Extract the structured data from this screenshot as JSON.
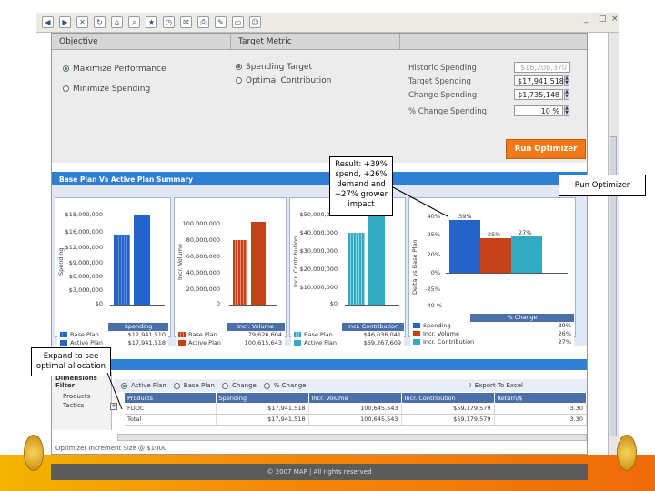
{
  "browser": {
    "window_controls": [
      "_",
      "□",
      "×"
    ]
  },
  "objective": {
    "header": "Objective",
    "options": [
      {
        "label": "Maximize Performance",
        "selected": true
      },
      {
        "label": "Minimize Spending",
        "selected": false
      }
    ]
  },
  "target_metric": {
    "header": "Target Metric",
    "options": [
      {
        "label": "Spending Target",
        "selected": true
      },
      {
        "label": "Optimal Contribution",
        "selected": false
      }
    ],
    "fields": [
      {
        "label": "Historic Spending",
        "value": "$16,206,370",
        "disabled": true
      },
      {
        "label": "Target Spending",
        "value": "$17,941,518",
        "disabled": false
      },
      {
        "label": "Change Spending",
        "value": "$1,735,148",
        "disabled": false
      },
      {
        "label": "% Change Spending",
        "value": "10 %",
        "disabled": false
      }
    ]
  },
  "run_button": {
    "label": "Run Optimizer"
  },
  "summary": {
    "title": "Base Plan Vs Active Plan Summary",
    "colors": {
      "base": "#2563c9",
      "volume": "#c6401a",
      "contribution": "#33aac0"
    },
    "spending_chart": {
      "ylabel": "Spending",
      "ticks": [
        "$18,000,000",
        "$16,000,000",
        "$12,000,000",
        "$9,000,000",
        "$6,000,000",
        "$3,000,000",
        "$0"
      ],
      "legend_header": "Spending",
      "rows": [
        {
          "label": "Base Plan",
          "value": "$12,941,510"
        },
        {
          "label": "Active Plan",
          "value": "$17,941,518"
        }
      ]
    },
    "volume_chart": {
      "ylabel": "Incr. Volume",
      "ticks": [
        "100,000,000",
        "80,000,000",
        "60,000,000",
        "40,000,000",
        "20,000,000",
        "0"
      ],
      "legend_header": "Incr. Volume",
      "rows": [
        {
          "label": "Base Plan",
          "value": "79,626,604"
        },
        {
          "label": "Active Plan",
          "value": "100,615,643"
        }
      ]
    },
    "contribution_chart": {
      "ylabel": "Incr. Contribution",
      "ticks": [
        "$50,000,000",
        "$40,000,000",
        "$30,000,000",
        "$20,000,000",
        "$10,000,000",
        "$0"
      ],
      "legend_header": "Incr. Contribution",
      "rows": [
        {
          "label": "Base Plan",
          "value": "$46,036,041"
        },
        {
          "label": "Active Plan",
          "value": "$69,267,609"
        }
      ]
    },
    "delta_chart": {
      "ylabel": "Delta vs Base Plan",
      "ticks": [
        "40%",
        "25%",
        "20%",
        "0%",
        "-25%",
        "-40 %"
      ],
      "bar_labels": [
        "39%",
        "25%",
        "27%"
      ],
      "legend_header": "% Change",
      "rows": [
        {
          "label": "Spending",
          "value": "39%"
        },
        {
          "label": "Incr. Volume",
          "value": "26%"
        },
        {
          "label": "Incr. Contribution",
          "value": "27%"
        }
      ]
    }
  },
  "details": {
    "dimension_label": "Dimensions Filter",
    "tree": [
      "Products",
      "Tactics"
    ],
    "view_options": [
      {
        "label": "Active Plan",
        "selected": true
      },
      {
        "label": "Base Plan",
        "selected": false
      },
      {
        "label": "Change",
        "selected": false
      },
      {
        "label": "% Change",
        "selected": false
      }
    ],
    "export_label": "Export To Excel",
    "columns": [
      "Products",
      "Spending",
      "Incr. Volume",
      "Incr. Contribution",
      "Return/$"
    ],
    "rows": [
      [
        "FDOC",
        "$17,941,518",
        "100,645,543",
        "$59,179,579",
        "3.30"
      ],
      [
        "Total",
        "$17,941,518",
        "100,645,543",
        "$59,179,579",
        "3.30"
      ]
    ],
    "increment_note": "Optimizer Increment Size @ $1000"
  },
  "footer": {
    "copyright": "© 2007 MAP | All rights reserved"
  },
  "callouts": {
    "result": "Result: +39% spend, +26% demand and +27% grower impact",
    "run": "Run Optimizer",
    "expand": "Expand to see optimal allocation"
  }
}
